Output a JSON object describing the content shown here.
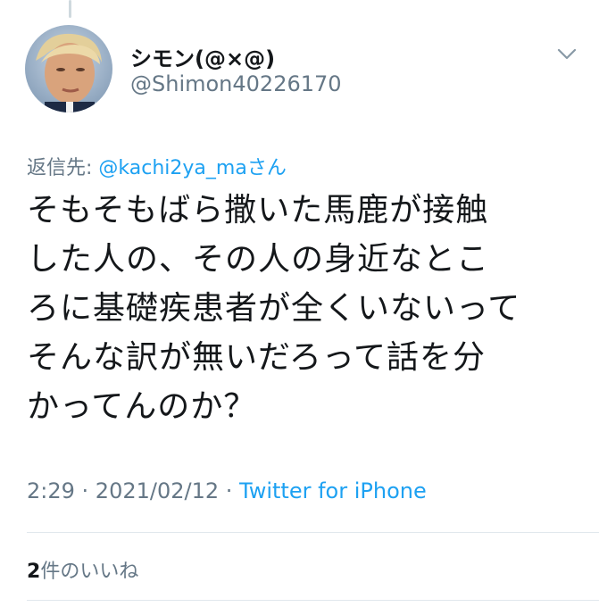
{
  "tweet": {
    "author_name": "シモン(@×@)",
    "author_handle": "@Shimon40226170",
    "reply_prefix": "返信先: ",
    "reply_mention": "@kachi2ya_ma",
    "reply_suffix": "さん",
    "text_lines": [
      "そもそもばら撒いた馬鹿が接触",
      "した人の、その人の身近なとこ",
      "ろに基礎疾患者が全くいないって",
      "そんな訳が無いだろって話を分",
      "かってんのか？"
    ],
    "time": "2:29",
    "date": "2021/02/12",
    "separator": " · ",
    "source": "Twitter for iPhone",
    "likes_count": "2",
    "likes_label": "件のいいね"
  },
  "icons": {
    "avatar": "avatar-photo",
    "menu": "chevron-down-icon"
  },
  "colors": {
    "link": "#1da1f2",
    "secondary_text": "#657786",
    "primary_text": "#14171a",
    "divider": "#e1e8ed"
  }
}
